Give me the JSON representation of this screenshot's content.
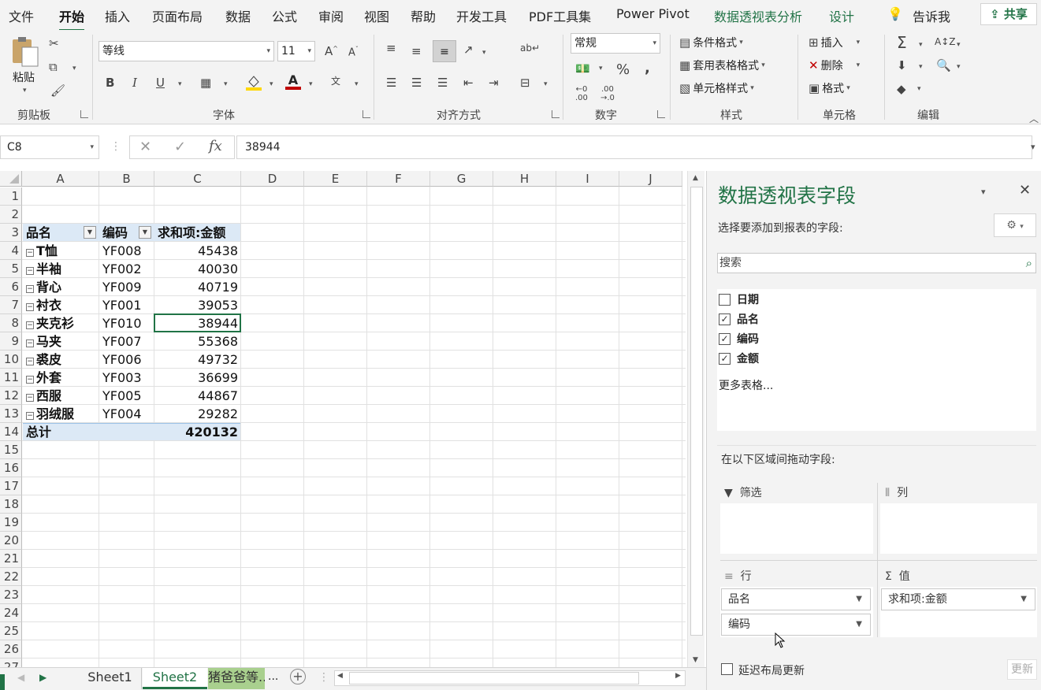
{
  "menu": {
    "items": [
      "文件",
      "开始",
      "插入",
      "页面布局",
      "数据",
      "公式",
      "审阅",
      "视图",
      "帮助",
      "开发工具",
      "PDF工具集",
      "Power Pivot",
      "数据透视表分析",
      "设计"
    ],
    "tell": "告诉我",
    "share": "共享"
  },
  "ribbon": {
    "clipboard": {
      "paste": "粘贴",
      "label": "剪贴板"
    },
    "font": {
      "name": "等线",
      "size": "11",
      "label": "字体",
      "bold": "B",
      "italic": "I",
      "underline": "U"
    },
    "align": {
      "label": "对齐方式"
    },
    "number": {
      "format": "常规",
      "label": "数字",
      "percent": "%",
      "comma": ","
    },
    "styles": {
      "cond": "条件格式",
      "table": "套用表格格式",
      "cell": "单元格样式",
      "label": "样式"
    },
    "cells": {
      "insert": "插入",
      "delete": "删除",
      "format": "格式",
      "label": "单元格"
    },
    "editing": {
      "label": "编辑"
    }
  },
  "formula": {
    "namebox": "C8",
    "fx": "fx",
    "value": "38944"
  },
  "grid": {
    "columns": [
      "A",
      "B",
      "C",
      "D",
      "E",
      "F",
      "G",
      "H",
      "I",
      "J"
    ],
    "rows": [
      "1",
      "2",
      "3",
      "4",
      "5",
      "6",
      "7",
      "8",
      "9",
      "10",
      "11",
      "12",
      "13",
      "14",
      "15",
      "16",
      "17",
      "18",
      "19",
      "20",
      "21",
      "22",
      "23",
      "24",
      "25",
      "26",
      "27"
    ],
    "pivot": {
      "headers": [
        "品名",
        "编码",
        "求和项:金额"
      ],
      "rows": [
        {
          "name": "T恤",
          "code": "YF008",
          "amount": "45438"
        },
        {
          "name": "半袖",
          "code": "YF002",
          "amount": "40030"
        },
        {
          "name": "背心",
          "code": "YF009",
          "amount": "40719"
        },
        {
          "name": "衬衣",
          "code": "YF001",
          "amount": "39053"
        },
        {
          "name": "夹克衫",
          "code": "YF010",
          "amount": "38944"
        },
        {
          "name": "马夹",
          "code": "YF007",
          "amount": "55368"
        },
        {
          "name": "裘皮",
          "code": "YF006",
          "amount": "49732"
        },
        {
          "name": "外套",
          "code": "YF003",
          "amount": "36699"
        },
        {
          "name": "西服",
          "code": "YF005",
          "amount": "44867"
        },
        {
          "name": "羽绒服",
          "code": "YF004",
          "amount": "29282"
        }
      ],
      "total_label": "总计",
      "total_value": "420132"
    }
  },
  "tabs": {
    "items": [
      "Sheet1",
      "Sheet2",
      "猪爸爸等..."
    ],
    "active": "Sheet2",
    "more": "..."
  },
  "pane": {
    "title": "数据透视表字段",
    "subtitle": "选择要添加到报表的字段:",
    "search_placeholder": "搜索",
    "fields": [
      {
        "label": "日期",
        "checked": false
      },
      {
        "label": "品名",
        "checked": true
      },
      {
        "label": "编码",
        "checked": true
      },
      {
        "label": "金额",
        "checked": true
      }
    ],
    "more_tables": "更多表格...",
    "drag_hint": "在以下区域间拖动字段:",
    "areas": {
      "filter": "筛选",
      "columns": "列",
      "rows": "行",
      "values": "值",
      "row_fields": [
        "品名",
        "编码"
      ],
      "value_fields": [
        "求和项:金额"
      ]
    },
    "defer": "延迟布局更新",
    "update": "更新"
  },
  "colors": {
    "accent": "#217346",
    "header_fill": "#dce9f6"
  }
}
